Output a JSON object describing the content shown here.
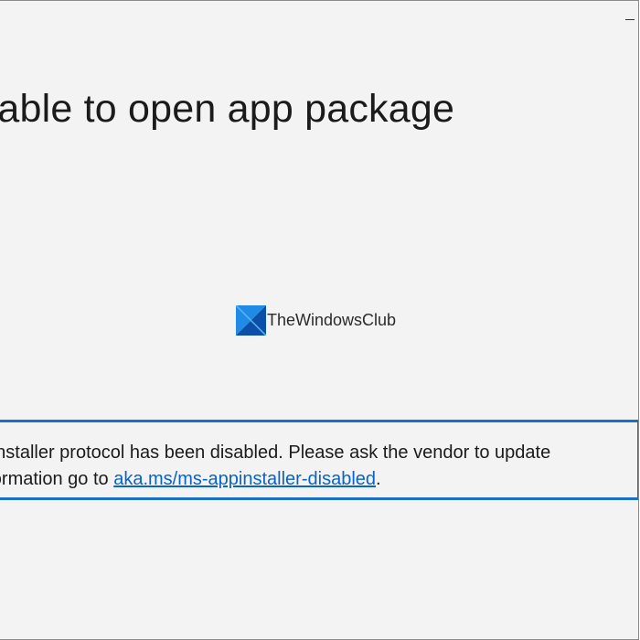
{
  "window": {
    "title": "Unable to open app package"
  },
  "message": {
    "line1": "The ms-appinstaller protocol has been disabled. Please ask the vendor to update",
    "line2_prefix": "For more information go to ",
    "link_text": "aka.ms/ms-appinstaller-disabled",
    "line2_suffix": "."
  },
  "watermark": {
    "text": "TheWindowsClub",
    "icon": "thewindowsclub-logo-icon"
  },
  "colors": {
    "background": "#f3f3f3",
    "accent": "#1a6fc9",
    "link": "#0a63c6",
    "text": "#1b1b1b"
  }
}
